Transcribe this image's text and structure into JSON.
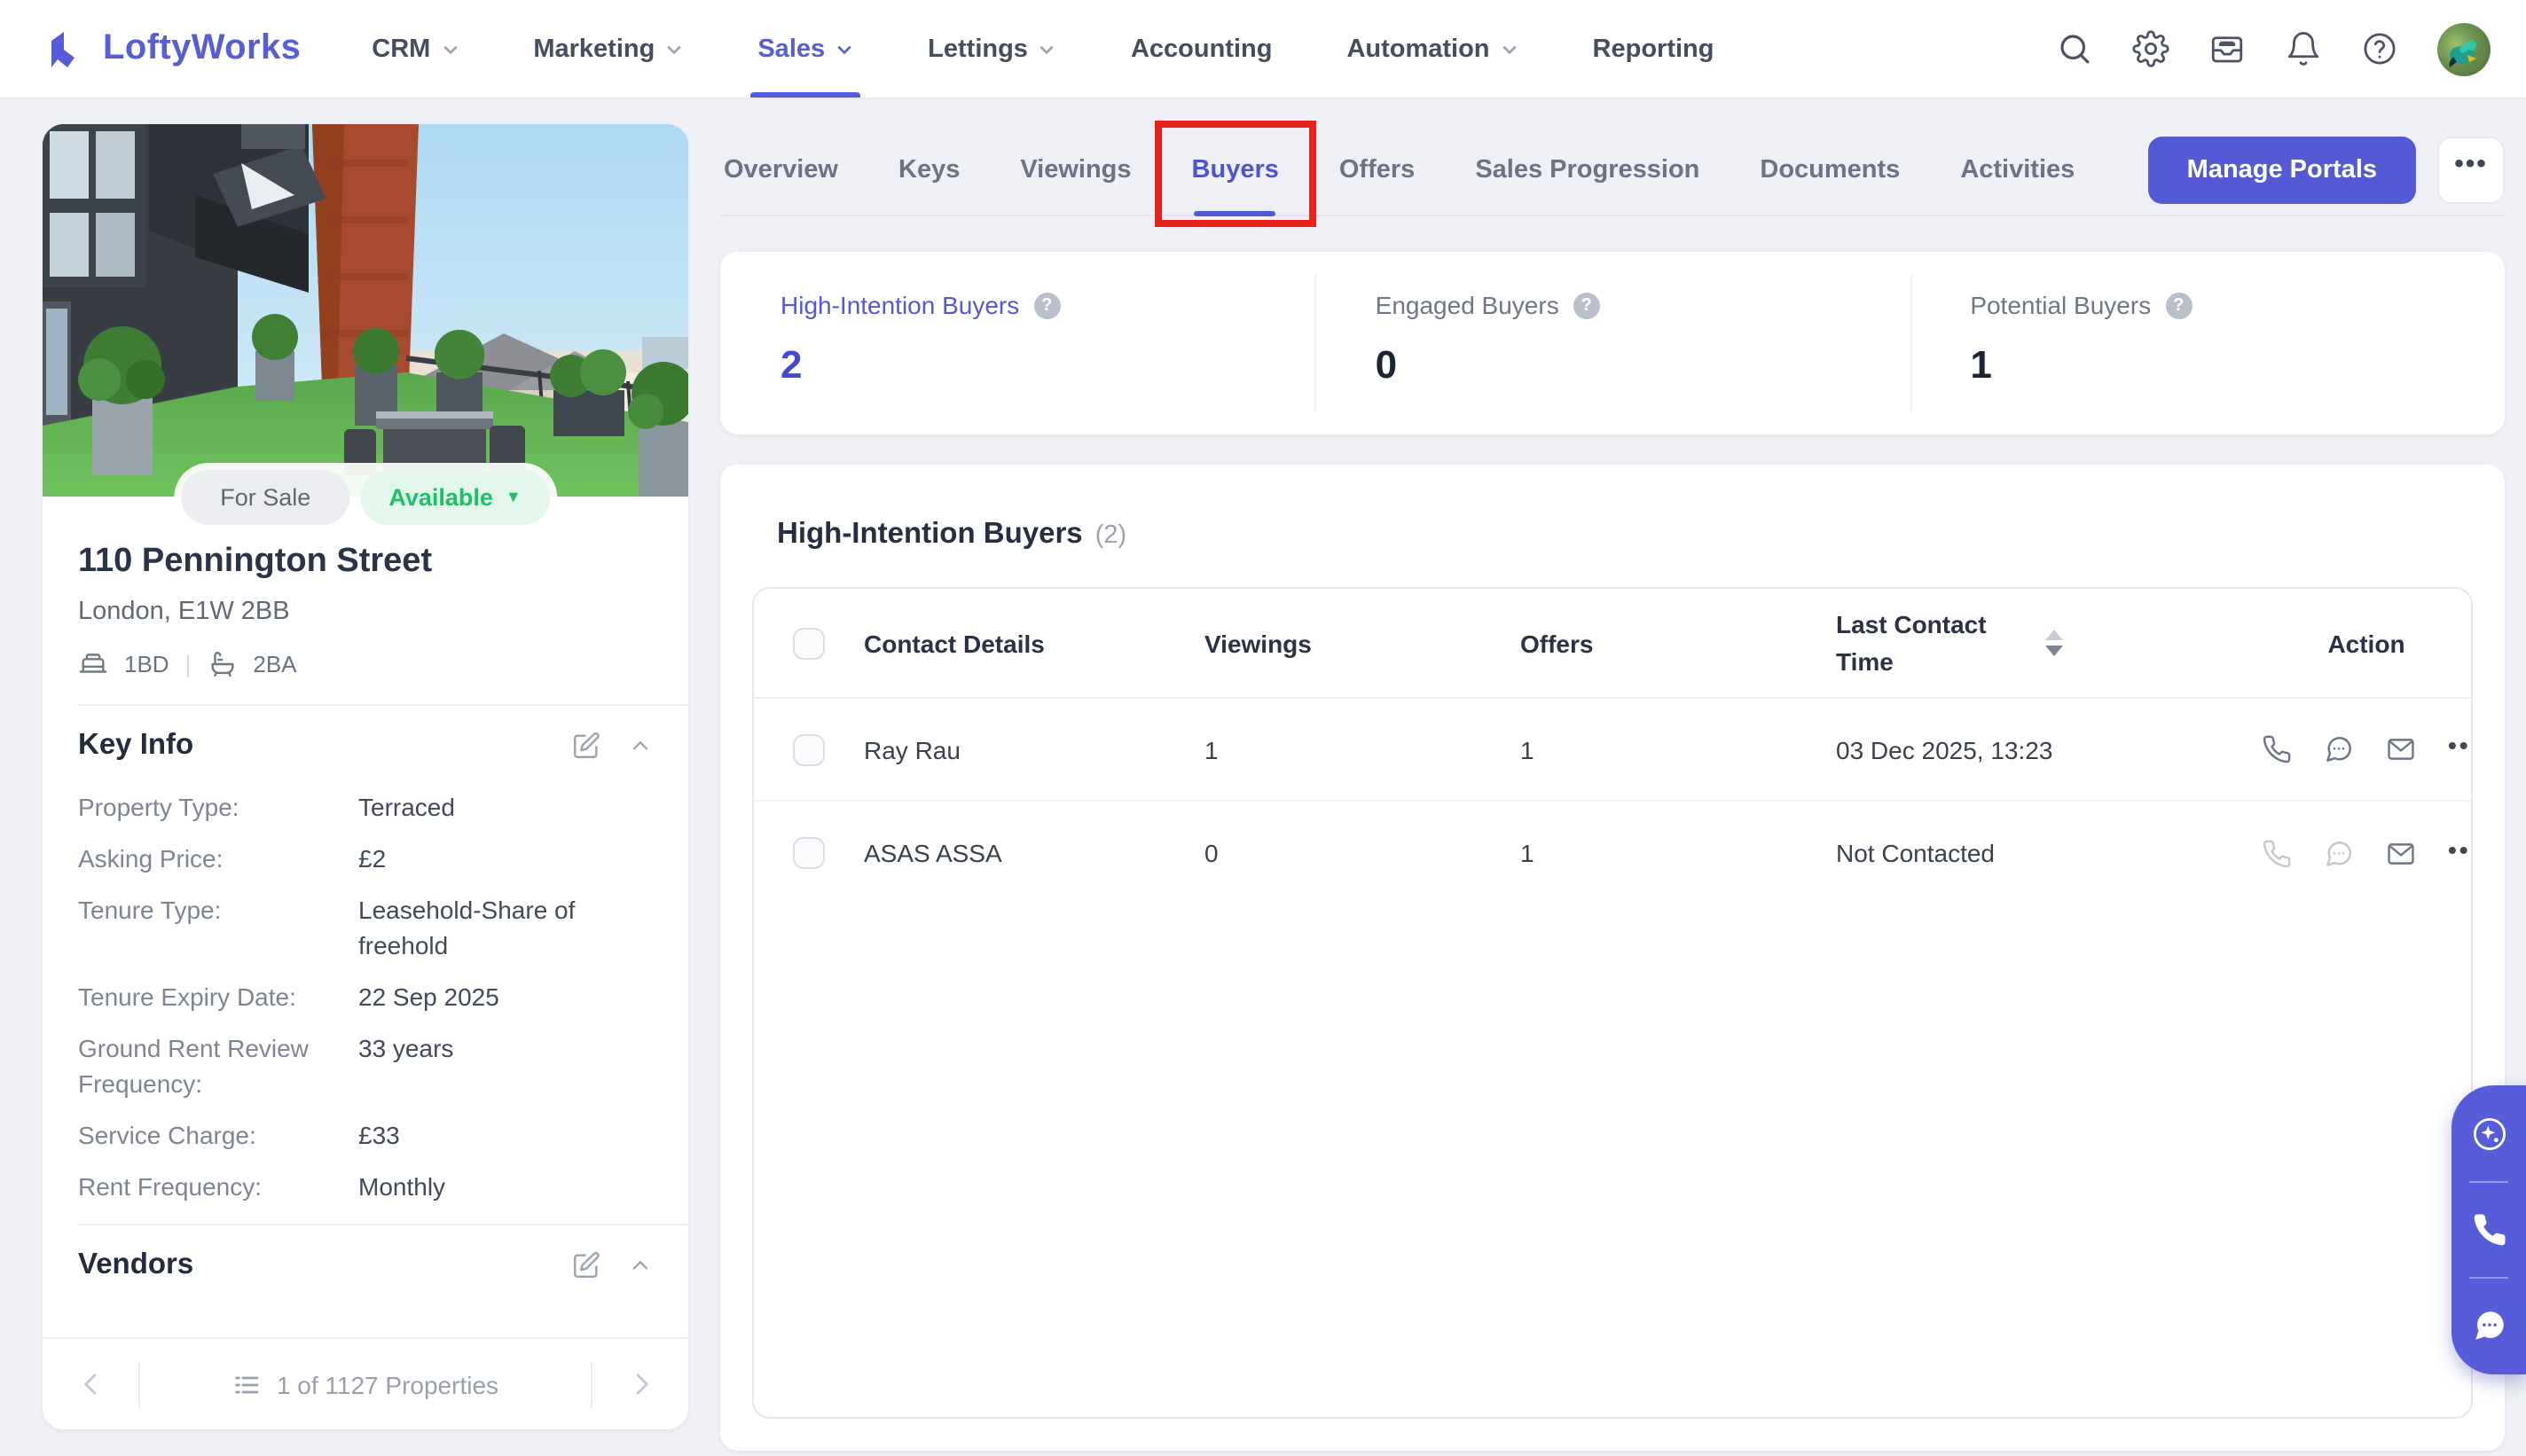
{
  "colors": {
    "accent": "#575cd8",
    "green": "#1fc068",
    "red_annotation": "#e7231b",
    "page_bg": "#eef0f5"
  },
  "brand": {
    "name": "LoftyWorks"
  },
  "nav": {
    "items": [
      {
        "label": "CRM",
        "dropdown": true,
        "active": false
      },
      {
        "label": "Marketing",
        "dropdown": true,
        "active": false
      },
      {
        "label": "Sales",
        "dropdown": true,
        "active": true
      },
      {
        "label": "Lettings",
        "dropdown": true,
        "active": false
      },
      {
        "label": "Accounting",
        "dropdown": false,
        "active": false
      },
      {
        "label": "Automation",
        "dropdown": true,
        "active": false
      },
      {
        "label": "Reporting",
        "dropdown": false,
        "active": false
      }
    ],
    "icons": [
      "search-icon",
      "gear-icon",
      "inbox-icon",
      "bell-icon",
      "help-icon",
      "avatar"
    ]
  },
  "property": {
    "sale_tag": "For Sale",
    "availability": "Available",
    "availability_caret": "▼",
    "title": "110 Pennington Street",
    "subtitle": "London, E1W 2BB",
    "beds": "1BD",
    "baths": "2BA",
    "meta_separator": "|",
    "key_info": {
      "title": "Key Info",
      "rows": [
        {
          "label": "Property Type:",
          "value": "Terraced"
        },
        {
          "label": "Asking Price:",
          "value": "£2"
        },
        {
          "label": "Tenure Type:",
          "value": "Leasehold-Share of freehold"
        },
        {
          "label": "Tenure Expiry Date:",
          "value": "22 Sep 2025"
        },
        {
          "label": "Ground Rent Review Frequency:",
          "value": "33 years"
        },
        {
          "label": "Service Charge:",
          "value": "£33"
        },
        {
          "label": "Rent Frequency:",
          "value": "Monthly"
        }
      ]
    },
    "vendors_title": "Vendors",
    "pagination_label": "1 of 1127 Properties"
  },
  "tabs": {
    "items": [
      {
        "label": "Overview",
        "active": false
      },
      {
        "label": "Keys",
        "active": false
      },
      {
        "label": "Viewings",
        "active": false
      },
      {
        "label": "Buyers",
        "active": true,
        "highlighted": true
      },
      {
        "label": "Offers",
        "active": false
      },
      {
        "label": "Sales Progression",
        "active": false
      },
      {
        "label": "Documents",
        "active": false
      },
      {
        "label": "Activities",
        "active": false
      }
    ]
  },
  "actions": {
    "manage_portals": "Manage Portals",
    "more": "•••"
  },
  "stats": [
    {
      "label": "High-Intention Buyers",
      "value": "2",
      "accent": true
    },
    {
      "label": "Engaged Buyers",
      "value": "0",
      "accent": false
    },
    {
      "label": "Potential Buyers",
      "value": "1",
      "accent": false
    }
  ],
  "buyers_table": {
    "title": "High-Intention Buyers",
    "count_display": "(2)",
    "columns": {
      "contact": "Contact Details",
      "viewings": "Viewings",
      "offers": "Offers",
      "last_contact": "Last Contact Time",
      "action": "Action"
    },
    "rows": [
      {
        "name": "Ray Rau",
        "viewings": "1",
        "offers": "1",
        "last_contact": "03 Dec 2025, 13:23",
        "contact_enabled": true
      },
      {
        "name": "ASAS ASSA",
        "viewings": "0",
        "offers": "1",
        "last_contact": "Not Contacted",
        "contact_enabled": false
      }
    ]
  },
  "dock_icons": [
    "sparkle-ai-icon",
    "phone-icon",
    "chat-icon"
  ]
}
